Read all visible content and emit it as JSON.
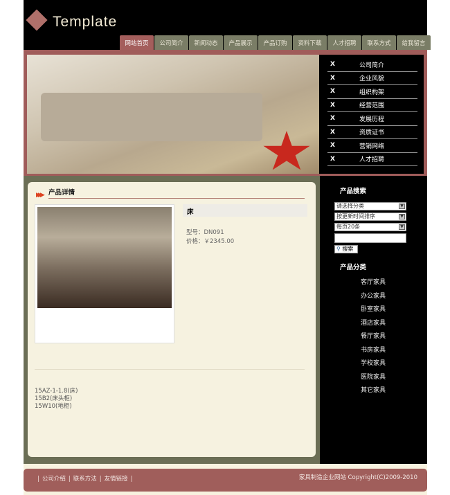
{
  "header": {
    "logo_text": "Template"
  },
  "nav": {
    "tabs": [
      "网站首页",
      "公司简介",
      "新闻动态",
      "产品展示",
      "产品订购",
      "资料下载",
      "人才招聘",
      "联系方式",
      "给我留言"
    ],
    "active": 0
  },
  "banner_menu": {
    "marker": "X",
    "items": [
      "公司简介",
      "企业风貌",
      "组织构架",
      "经营范围",
      "发展历程",
      "资质证书",
      "营销网络",
      "人才招聘"
    ]
  },
  "product": {
    "section_title": "产品详情",
    "name": "床",
    "model": "型号：DN091",
    "price": "价格：￥2345.00",
    "description": [
      "15AZ-1-1.8(床)",
      "15B2(床头柜)",
      "15W10(地柜)"
    ]
  },
  "sidebar": {
    "search_title": "产品搜索",
    "category_select": "请选择分类",
    "sort_select": "按更新时间排序",
    "page_select": "每页20条",
    "keyword_value": "",
    "search_button": "搜索",
    "category_title": "产品分类",
    "categories": [
      "客厅家具",
      "办公家具",
      "卧室家具",
      "酒店家具",
      "餐厅家具",
      "书房家具",
      "学校家具",
      "医院家具",
      "其它家具"
    ]
  },
  "footer": {
    "links": [
      "公司介绍",
      "联系方法",
      "友情链接"
    ],
    "separator": "|",
    "copyright": "家具制造企业网站  Copyright(C)2009-2010"
  },
  "colors": {
    "accent": "#a05c5a",
    "olive": "#6b6e55",
    "cream": "#f6f2e0",
    "nav_tab": "#7a7d66"
  }
}
